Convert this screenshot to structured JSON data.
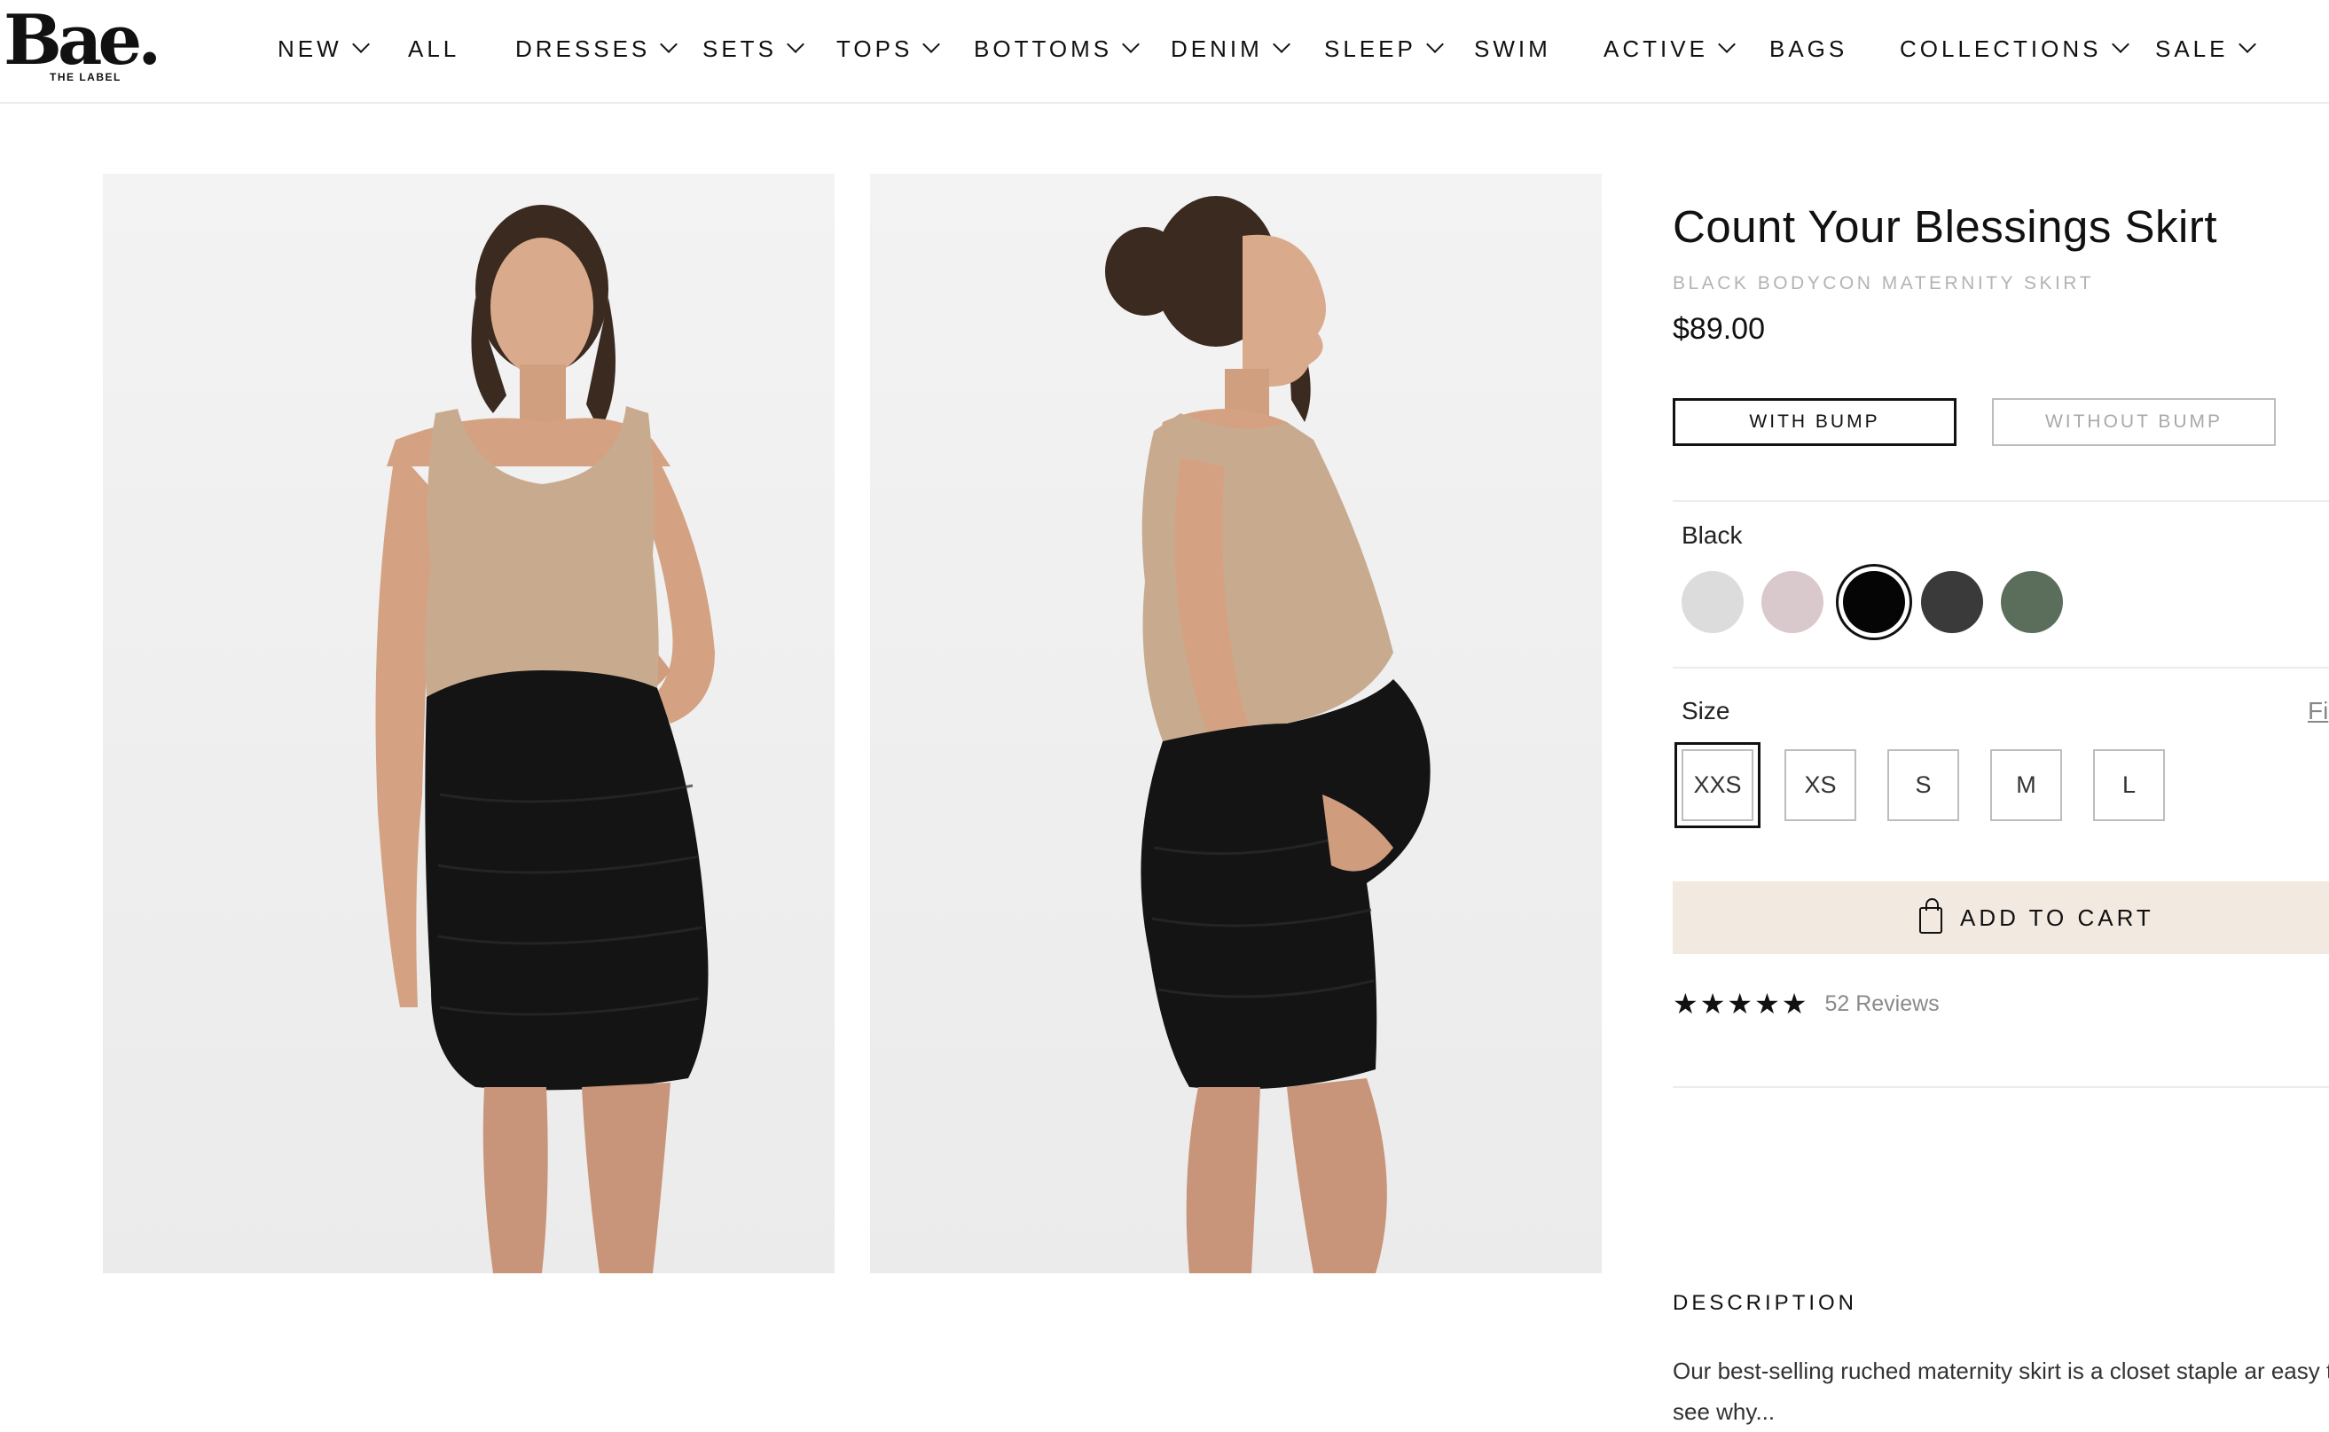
{
  "brand": {
    "logo": "Bae.",
    "tagline": "THE LABEL"
  },
  "nav": {
    "items": [
      {
        "label": "NEW",
        "dropdown": true
      },
      {
        "label": "ALL",
        "dropdown": false
      },
      {
        "label": "DRESSES",
        "dropdown": true
      },
      {
        "label": "SETS",
        "dropdown": true
      },
      {
        "label": "TOPS",
        "dropdown": true
      },
      {
        "label": "BOTTOMS",
        "dropdown": true
      },
      {
        "label": "DENIM",
        "dropdown": true
      },
      {
        "label": "SLEEP",
        "dropdown": true
      },
      {
        "label": "SWIM",
        "dropdown": false
      },
      {
        "label": "ACTIVE",
        "dropdown": true
      },
      {
        "label": "BAGS",
        "dropdown": false
      },
      {
        "label": "COLLECTIONS",
        "dropdown": true
      },
      {
        "label": "SALE",
        "dropdown": true
      }
    ]
  },
  "product": {
    "title": "Count Your Blessings Skirt",
    "subtitle": "BLACK BODYCON MATERNITY SKIRT",
    "price": "$89.00",
    "bump_options": {
      "active": "WITH BUMP",
      "inactive": "WITHOUT BUMP"
    },
    "color_label": "Black",
    "swatches": [
      "#dcdcdc",
      "#d9c8cc",
      "#050505",
      "#3a3a3a",
      "#5b6e5c"
    ],
    "selected_swatch_index": 2,
    "size_label": "Size",
    "fit_link": "Fi",
    "sizes": [
      "XXS",
      "XS",
      "S",
      "M",
      "L"
    ],
    "selected_size": "XXS",
    "add_to_cart": "ADD TO CART",
    "rating_stars": 5,
    "reviews": "52 Reviews",
    "description_heading": "DESCRIPTION",
    "description_text": "Our best-selling ruched maternity skirt is a closet staple ar easy to see why..."
  },
  "colors": {
    "accent_cart_bg": "#f2e9e1",
    "photo_bg": "#eeeeee"
  }
}
